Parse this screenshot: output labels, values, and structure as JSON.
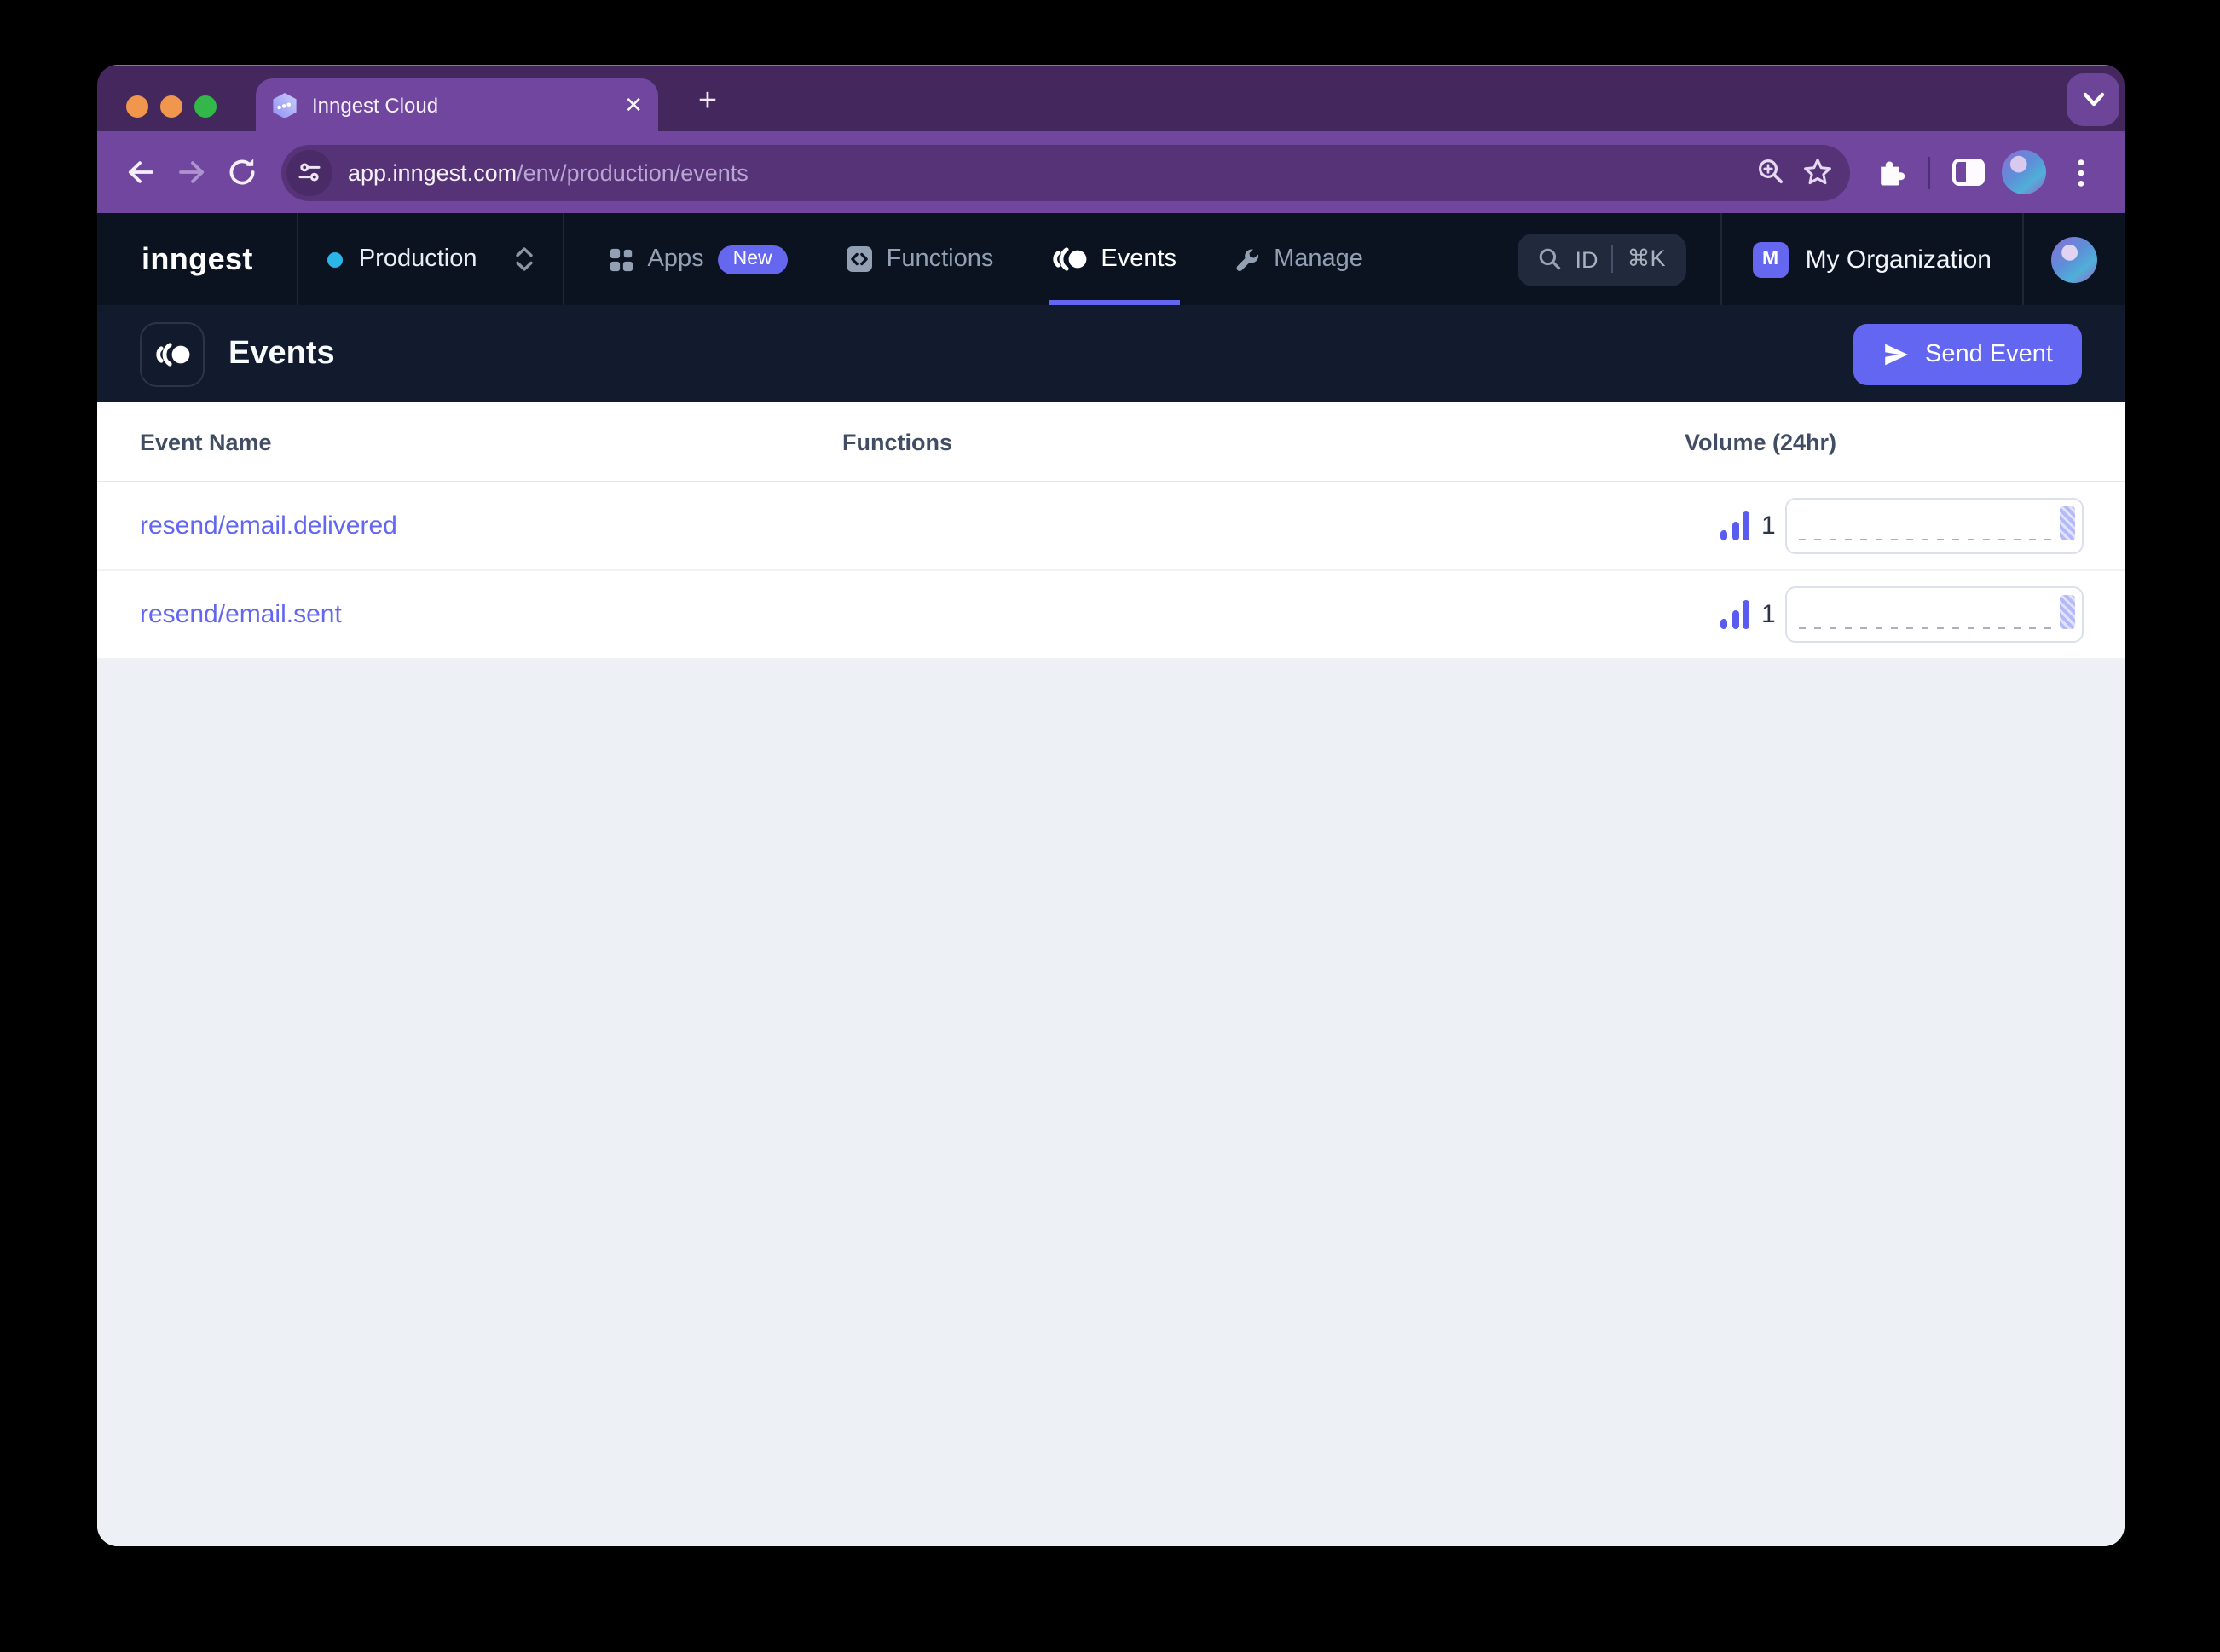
{
  "browser": {
    "window_controls": [
      "close",
      "minimize",
      "zoom"
    ],
    "tab": {
      "title": "Inngest Cloud",
      "close_glyph": "✕"
    },
    "new_tab_label": "+",
    "url": {
      "host": "app.inngest.com",
      "path": "/env/production/events"
    }
  },
  "nav": {
    "logo": "inngest",
    "environment": {
      "label": "Production",
      "dot_color": "#2CB5E9"
    },
    "items": [
      {
        "label": "Apps",
        "badge": "New",
        "active": false
      },
      {
        "label": "Functions",
        "active": false
      },
      {
        "label": "Events",
        "active": true
      },
      {
        "label": "Manage",
        "active": false
      }
    ],
    "search": {
      "label": "ID",
      "shortcut": "⌘K"
    },
    "organization": {
      "initial": "M",
      "name": "My Organization"
    }
  },
  "page": {
    "title": "Events",
    "send_event_label": "Send Event"
  },
  "table": {
    "columns": [
      "Event Name",
      "Functions",
      "Volume (24hr)"
    ],
    "rows": [
      {
        "name": "resend/email.delivered",
        "functions": "",
        "volume": "1",
        "chart_bars": [
          1
        ]
      },
      {
        "name": "resend/email.sent",
        "functions": "",
        "volume": "1",
        "chart_bars": [
          1
        ]
      }
    ]
  },
  "colors": {
    "accent": "#6366F1",
    "frame_purple": "#44275D",
    "toolbar_purple": "#71469E",
    "nav_bg": "#0B1220",
    "page_header_bg": "#121B2D"
  }
}
